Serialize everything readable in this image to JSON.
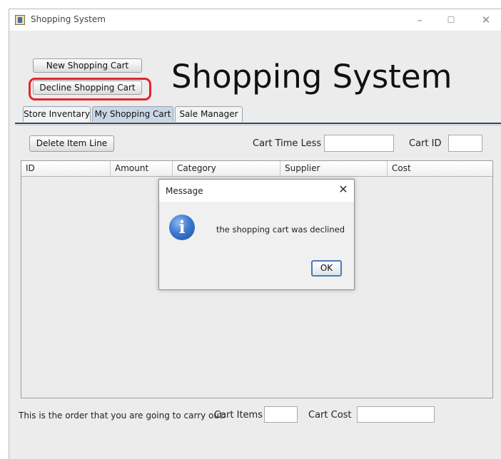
{
  "window": {
    "title": "Shopping System",
    "controls": {
      "minimize": "–",
      "maximize": "☐",
      "close": "✕"
    }
  },
  "header": {
    "new_cart_label": "New Shopping Cart",
    "decline_cart_label": "Decline Shopping Cart",
    "big_title": "Shopping System"
  },
  "tabs": [
    {
      "label": "Store Inventary",
      "active": false
    },
    {
      "label": "My Shopping Cart",
      "active": true
    },
    {
      "label": "Sale Manager",
      "active": false
    }
  ],
  "toolbar": {
    "delete_label": "Delete Item Line",
    "time_label": "Cart Time Less",
    "time_value": "",
    "cart_id_label": "Cart ID",
    "cart_id_value": ""
  },
  "table": {
    "columns": [
      "ID",
      "Amount",
      "Category",
      "Supplier",
      "Cost"
    ],
    "rows": []
  },
  "footer": {
    "order_text": "This is the order that you are going to carry out:",
    "items_label": "Cart Items",
    "items_value": "",
    "cost_label": "Cart Cost",
    "cost_value": ""
  },
  "dialog": {
    "title": "Message",
    "close": "✕",
    "icon": "info-icon",
    "message": "the shopping cart was declined",
    "ok_label": "OK"
  },
  "colors": {
    "highlight": "#e3252b",
    "active_tab": "#c9d6e6",
    "info_blue": "#3c7bd3"
  }
}
